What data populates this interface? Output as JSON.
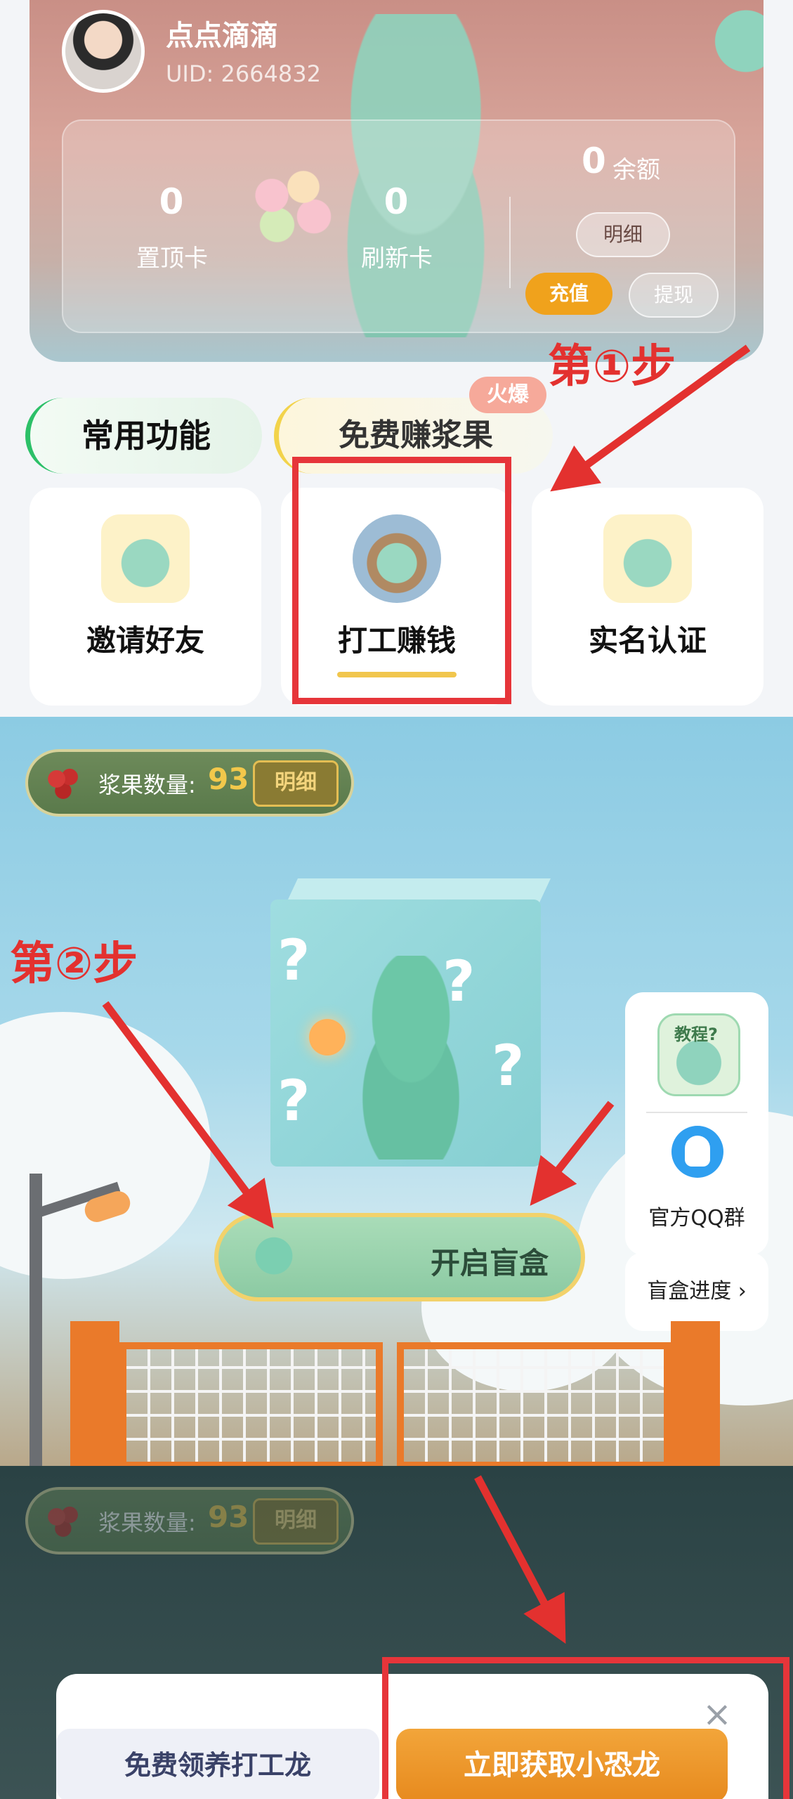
{
  "profile": {
    "username": "点点滴滴",
    "uid": "UID: 2664832",
    "pin_cards": {
      "value": "0",
      "label": "置顶卡"
    },
    "refresh_cards": {
      "value": "0",
      "label": "刷新卡"
    },
    "balance": {
      "value": "0",
      "label": "余额"
    },
    "detail_label": "明细",
    "recharge_label": "充值",
    "withdraw_label": "提现"
  },
  "annotations": {
    "step1": "第①步",
    "step2": "第②步",
    "highlight_color": "#e6353a"
  },
  "tabs": {
    "common": "常用功能",
    "earn": "免费赚浆果",
    "hot_badge": "火爆"
  },
  "functions": [
    {
      "label": "邀请好友",
      "icon": "dino-invite-icon"
    },
    {
      "label": "打工赚钱",
      "icon": "dino-work-icon"
    },
    {
      "label": "实名认证",
      "icon": "dino-verify-icon"
    }
  ],
  "blind_box": {
    "fruit_label": "浆果数量:",
    "fruit_count": "93",
    "fruit_detail": "明细",
    "open_label": "开启盲盒",
    "tutorial_label": "教程?",
    "qq_group_label": "官方QQ群",
    "progress_label": "盲盒进度 ›"
  },
  "overlay": {
    "fruit_label": "浆果数量:",
    "fruit_count": "93",
    "fruit_detail": "明细",
    "free_button": "免费领养打工龙",
    "get_button": "立即获取小恐龙",
    "close_icon": "×"
  },
  "colors": {
    "accent_orange": "#f0a21c",
    "tab_green": "#2cc068",
    "tab_yellow": "#f2d34b",
    "arrow_red": "#e3312f"
  }
}
